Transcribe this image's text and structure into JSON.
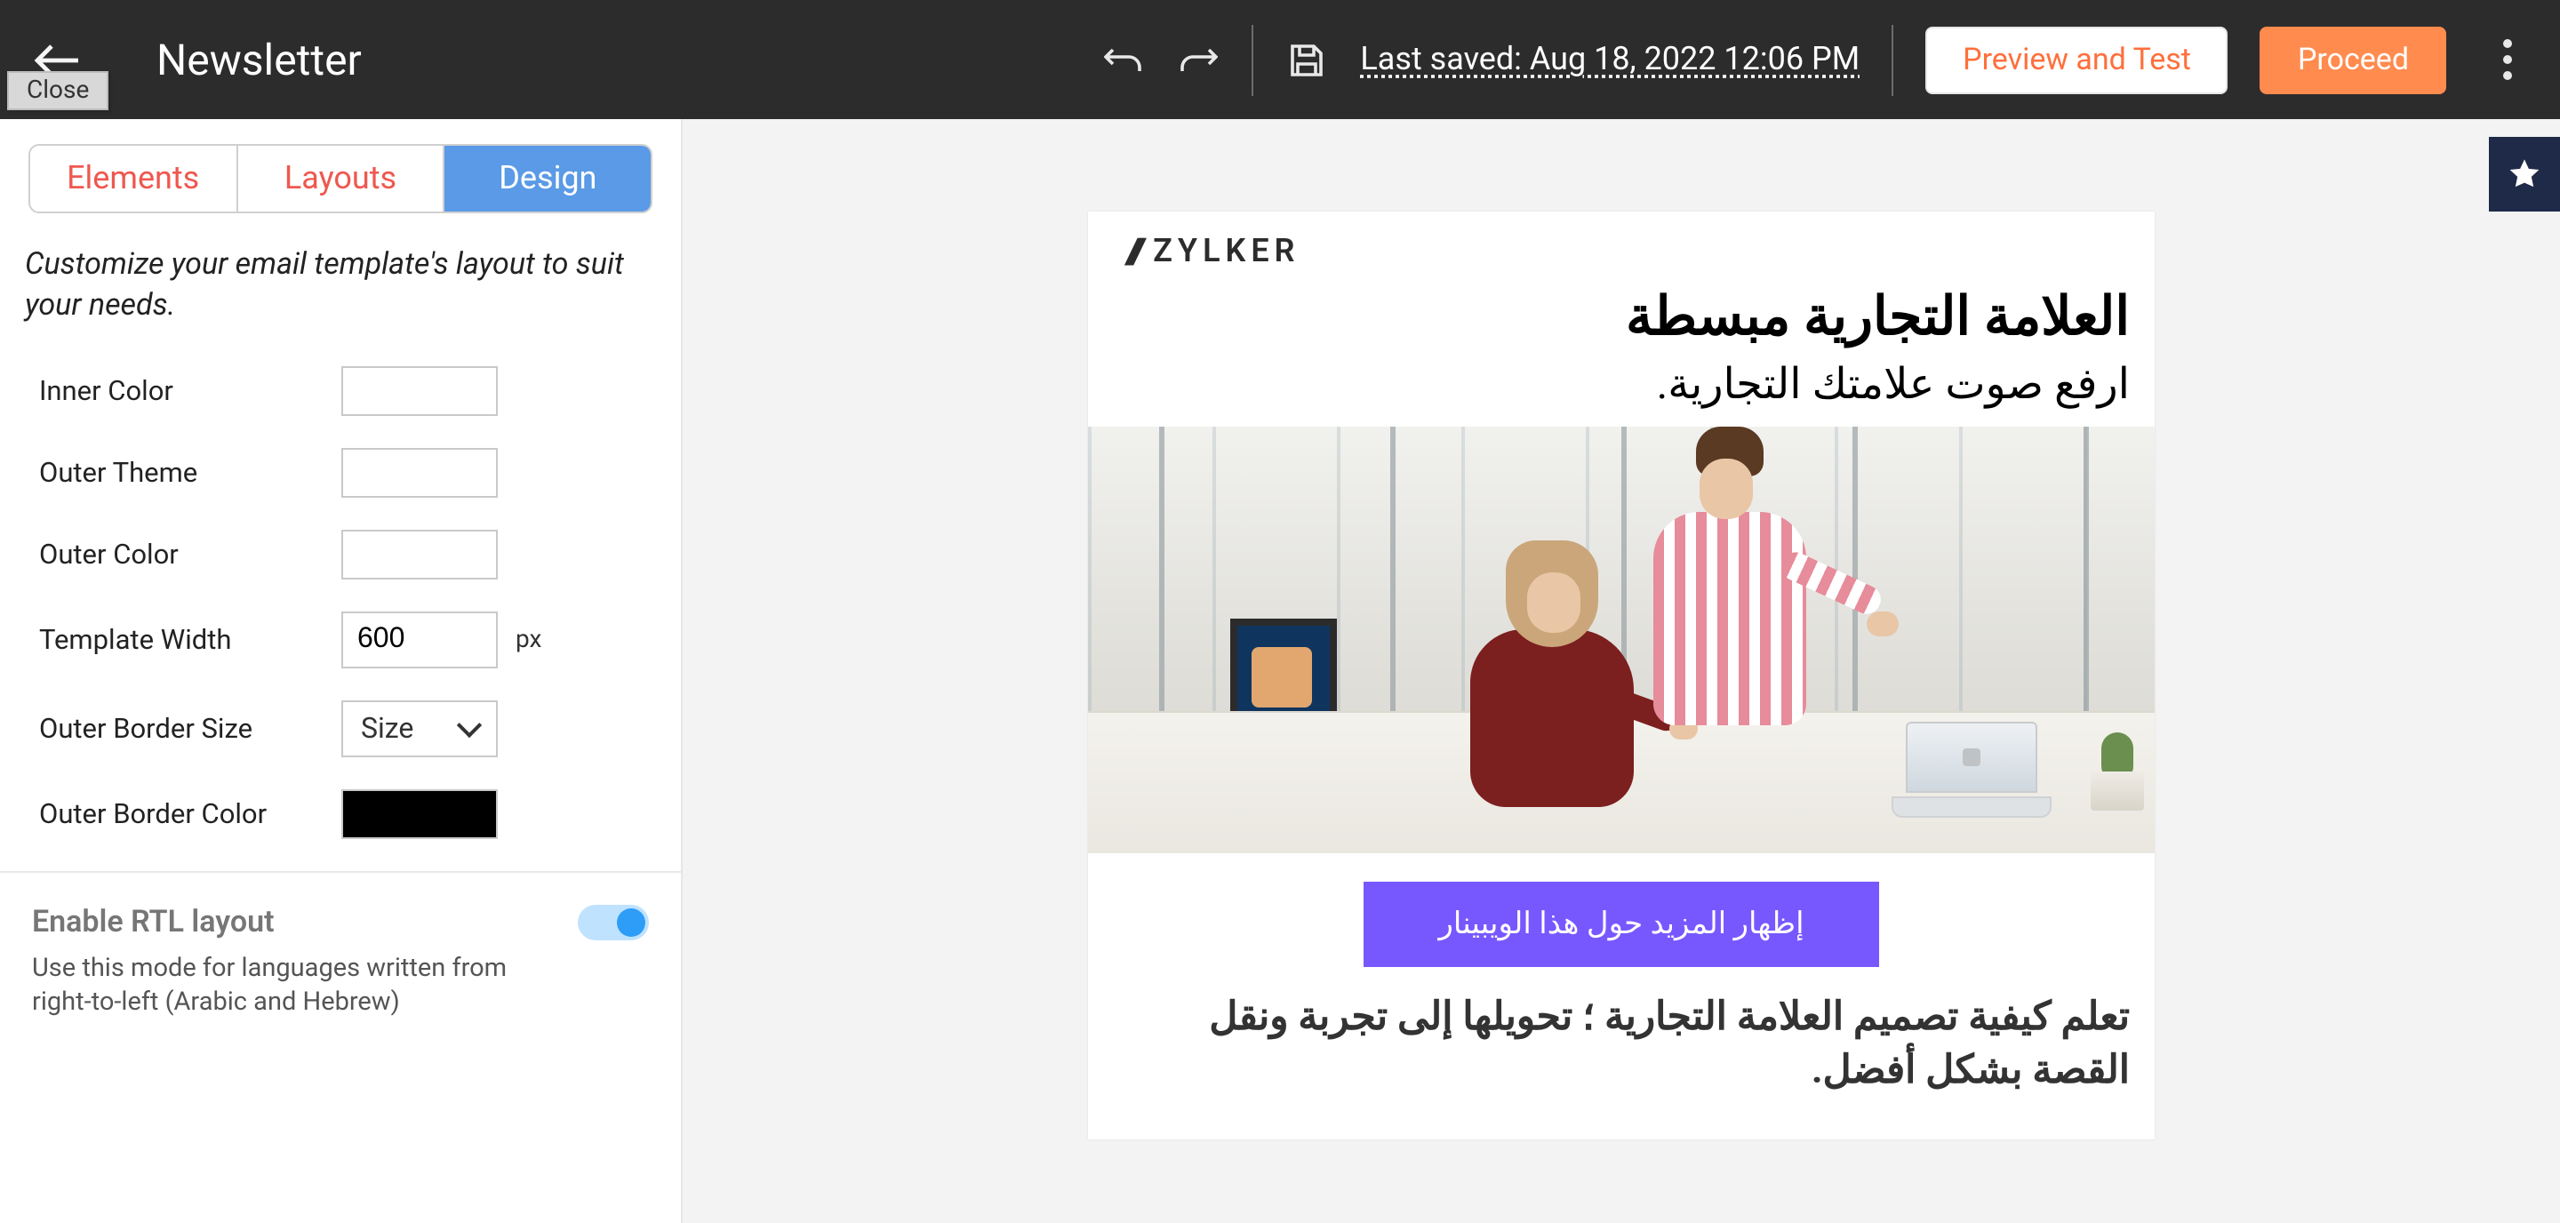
{
  "header": {
    "close_label": "Close",
    "page_title": "Newsletter",
    "last_saved": "Last saved: Aug 18, 2022 12:06 PM",
    "preview_label": "Preview and Test",
    "proceed_label": "Proceed"
  },
  "tabs": {
    "elements": "Elements",
    "layouts": "Layouts",
    "design": "Design",
    "active": "design"
  },
  "design": {
    "description": "Customize your email template's layout to suit your needs.",
    "inner_color_label": "Inner Color",
    "outer_theme_label": "Outer Theme",
    "outer_color_label": "Outer Color",
    "template_width_label": "Template Width",
    "template_width_value": "600",
    "template_width_unit": "px",
    "outer_border_size_label": "Outer Border Size",
    "outer_border_size_value": "Size",
    "outer_border_color_label": "Outer Border Color",
    "outer_border_color_value": "#000000",
    "rtl_title": "Enable RTL layout",
    "rtl_help": "Use this mode for languages written from right-to-left (Arabic and Hebrew)",
    "rtl_enabled": true
  },
  "email": {
    "brand": "ZYLKER",
    "hero_title": "العلامة التجارية مبسطة",
    "hero_sub": "ارفع صوت علامتك التجارية.",
    "cta": "إظهار المزيد حول هذا الويبينار",
    "body_copy": "تعلم كيفية تصميم العلامة التجارية ؛ تحويلها إلى تجربة ونقل القصة بشكل أفضل."
  }
}
